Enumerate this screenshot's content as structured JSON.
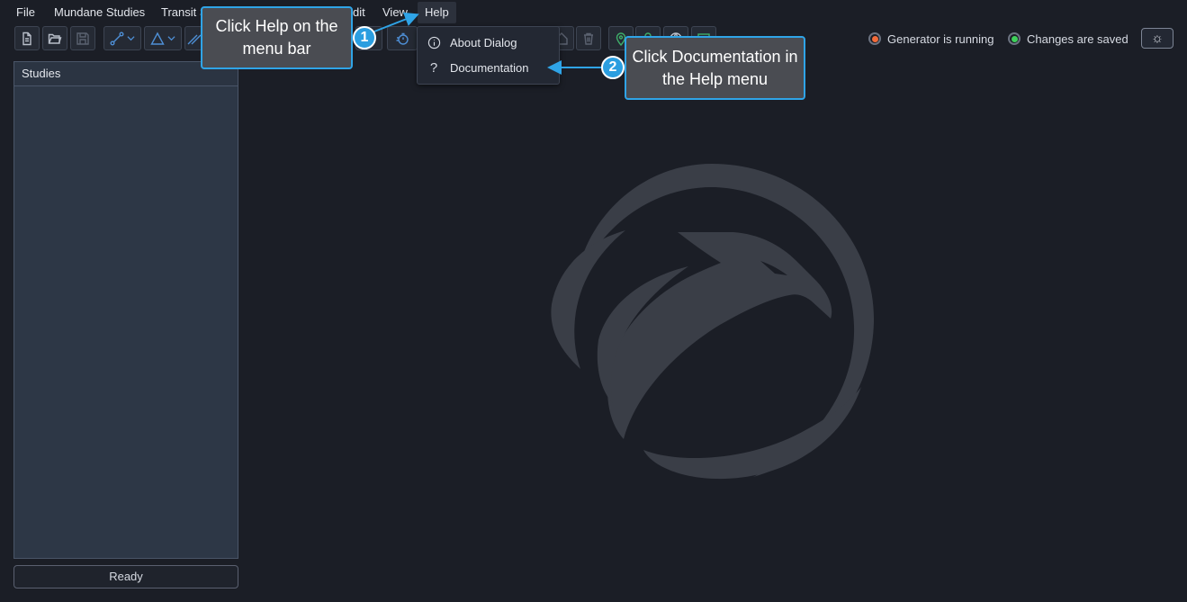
{
  "menu": {
    "file": "File",
    "mundane": "Mundane Studies",
    "transit": "Transit S",
    "edit": "dit",
    "view": "View",
    "help": "Help"
  },
  "help_menu": {
    "about": "About Dialog",
    "documentation": "Documentation"
  },
  "status": {
    "generator": "Generator is running",
    "generator_color": "#f26b3a",
    "saved": "Changes are saved",
    "saved_color": "#3ecf5a"
  },
  "studies": {
    "title": "Studies"
  },
  "statusbar": {
    "ready": "Ready"
  },
  "callouts": {
    "step1_number": "1",
    "step1_text": "Click Help on the menu bar",
    "step2_number": "2",
    "step2_text": "Click Documentation in the Help menu"
  },
  "colors": {
    "background": "#1b1e26",
    "accent": "#2fa4e7",
    "panel": "#2d3746"
  }
}
